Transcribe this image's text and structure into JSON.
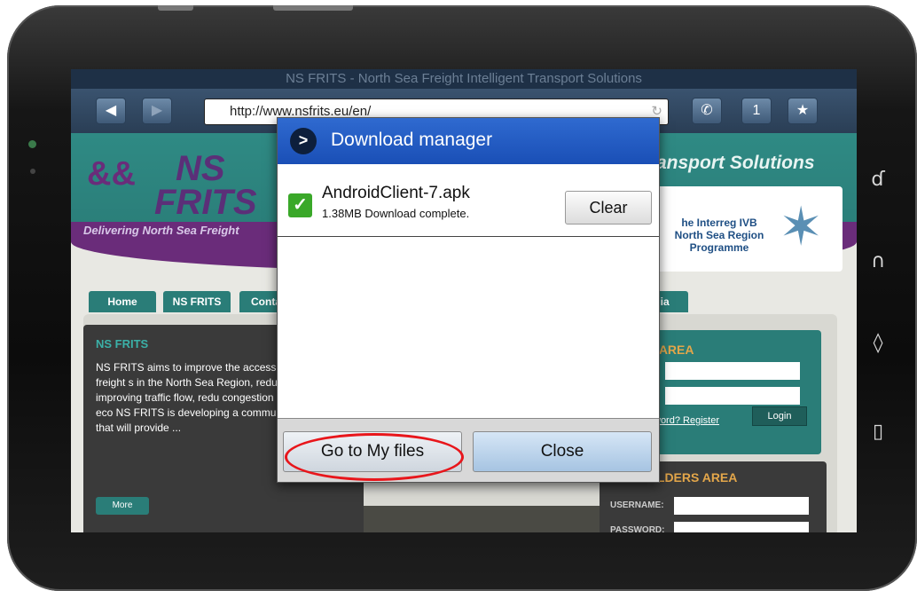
{
  "browser": {
    "title": "NS FRITS - North Sea Freight Intelligent Transport Solutions",
    "url": "http://www.nsfrits.eu/en/",
    "back_icon": "arrow-left-icon",
    "forward_icon": "arrow-right-icon",
    "reload_icon": "reload-icon",
    "phone_icon": "phone-icon",
    "tabs_count": "1",
    "bookmark_icon": "bookmark-star-icon"
  },
  "site": {
    "logo_ns": "NS",
    "logo_frits": "FRITS",
    "logo_tagline": "Delivering North Sea Freight",
    "slogan": "ansport Solutions",
    "interreg_text": "he Interreg IVB\nNorth Sea Region\nProgramme",
    "nav": [
      "Home",
      "NS FRITS",
      "Conta",
      "lia"
    ],
    "left_panel_title": "NS FRITS",
    "left_panel_body": "NS FRITS aims to improve the accessibility for the road freight s in the North Sea Region, reducing crime, improving traffic flow, redu congestion and boosting the eco NS FRITS is developing a communications system that will provide ...",
    "more_label": "More",
    "members_title": "RS AREA",
    "members_link": "ssword? Register",
    "login_label": "Login",
    "holders_title": "OLDERS AREA",
    "username_label": "USERNAME:",
    "password_label": "PASSWORD:"
  },
  "dialog": {
    "title": "Download manager",
    "item": {
      "filename": "AndroidClient-7.apk",
      "status": "1.38MB Download complete."
    },
    "clear_label": "Clear",
    "goto_files_label": "Go to My files",
    "close_label": "Close"
  },
  "colors": {
    "dialog_header": "#1f56be",
    "highlight": "#e8161b",
    "check_green": "#3aa829",
    "site_teal": "#2a7d78",
    "site_purple": "#6a2c7a"
  }
}
